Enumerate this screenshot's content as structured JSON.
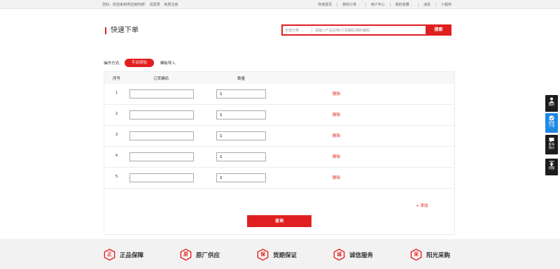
{
  "topbar": {
    "welcome": "您好，欢迎来到供应链商城!",
    "login": "请登录",
    "register": "免费注册",
    "links": [
      {
        "label": "商城首页",
        "dropdown": false
      },
      {
        "label": "我的订单",
        "dropdown": true
      },
      {
        "label": "用户中心",
        "dropdown": false
      },
      {
        "label": "我的收藏",
        "dropdown": true
      },
      {
        "label": "消息",
        "dropdown": false
      },
      {
        "label": "小程序",
        "dropdown": false
      }
    ]
  },
  "page": {
    "title": "快速下单"
  },
  "search": {
    "category": "全部分类",
    "placeholder": "请输入产品名称/订货编码/物料编码",
    "button": "搜索"
  },
  "operation": {
    "label": "操作方式:",
    "manual": "手动添加",
    "template": "模板导入"
  },
  "table": {
    "headers": {
      "index": "序号",
      "code": "订货编码",
      "qty": "数量"
    },
    "rows": [
      {
        "index": "1",
        "code": "",
        "qty": "1",
        "action": "删除"
      },
      {
        "index": "2",
        "code": "",
        "qty": "1",
        "action": "删除"
      },
      {
        "index": "3",
        "code": "",
        "qty": "1",
        "action": "删除"
      },
      {
        "index": "4",
        "code": "",
        "qty": "1",
        "action": "删除"
      },
      {
        "index": "5",
        "code": "",
        "qty": "1",
        "action": "删除"
      }
    ],
    "add": "+ 添加",
    "query": "查询"
  },
  "guarantees": [
    {
      "char": "正",
      "label": "正品保障"
    },
    {
      "char": "原",
      "label": "原厂供应"
    },
    {
      "char": "保",
      "label": "货期保证"
    },
    {
      "char": "诚",
      "label": "诚信服务"
    },
    {
      "char": "采",
      "label": "阳光采购"
    }
  ],
  "sidebar": [
    {
      "label1": "我的",
      "label2": "",
      "icon": "user-icon"
    },
    {
      "label1": "快速",
      "label2": "下单",
      "icon": "quick-order-icon"
    },
    {
      "label1": "发布",
      "label2": "询价",
      "icon": "inquiry-icon"
    },
    {
      "label1": "顶部",
      "label2": "",
      "icon": "back-to-top-icon"
    }
  ],
  "colors": {
    "accent": "#e02020",
    "side_dark": "#1c1c1c",
    "side_active": "#1e88e5"
  }
}
